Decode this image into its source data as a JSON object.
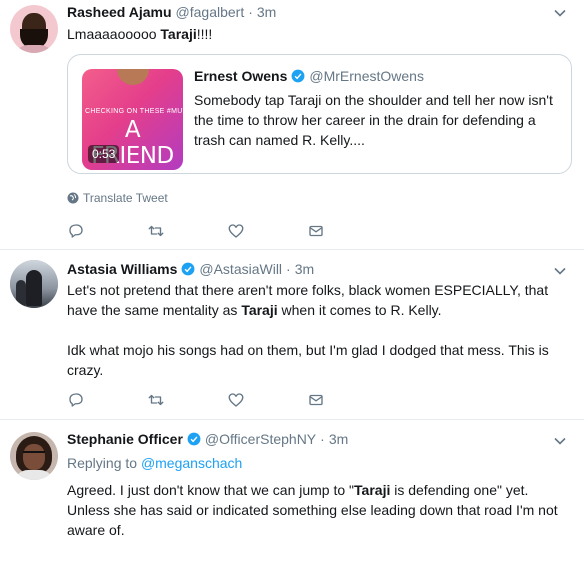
{
  "tweets": [
    {
      "author": "Rasheed Ajamu",
      "handle": "@fagalbert",
      "sep": "·",
      "time": "3m",
      "text_before": "Lmaaaaooooo ",
      "text_bold": "Taraji",
      "text_after": "!!!!",
      "quote": {
        "author": "Ernest Owens",
        "handle": "@MrErnestOwens",
        "text": "Somebody tap Taraji on the shoulder and tell her now isn't the time to throw her career in the drain for defending a trash can named R. Kelly....",
        "thumb_small": "CHECKING ON THESE #MUTE FOR",
        "thumb_big": "A FRIEND",
        "duration": "0:53"
      },
      "translate_label": "Translate Tweet"
    },
    {
      "author": "Astasia Williams",
      "handle": "@AstasiaWill",
      "sep": "·",
      "time": "3m",
      "para1_before": "Let's not pretend that there aren't more folks, black women ESPECIALLY, that have the same mentality as ",
      "para1_bold": "Taraji",
      "para1_after": " when it comes to R. Kelly.",
      "para2": "Idk what mojo his songs had on them, but I'm glad I dodged that mess. This is crazy."
    },
    {
      "author": "Stephanie Officer",
      "handle": "@OfficerStephNY",
      "sep": "·",
      "time": "3m",
      "replying_label": "Replying to ",
      "replying_to": "@meganschach",
      "text_before": "Agreed. I just don't know that we can jump to \"",
      "text_bold": "Taraji",
      "text_after": " is defending one\" yet. Unless she has said or indicated something else leading down that road I'm not aware of."
    }
  ],
  "colors": {
    "accent": "#1da1f2",
    "muted": "#657786",
    "text": "#14171a",
    "border": "#e6ecf0"
  },
  "icons": [
    "reply-icon",
    "retweet-icon",
    "like-icon",
    "message-icon",
    "verified-icon",
    "chevron-down-icon",
    "globe-icon"
  ]
}
